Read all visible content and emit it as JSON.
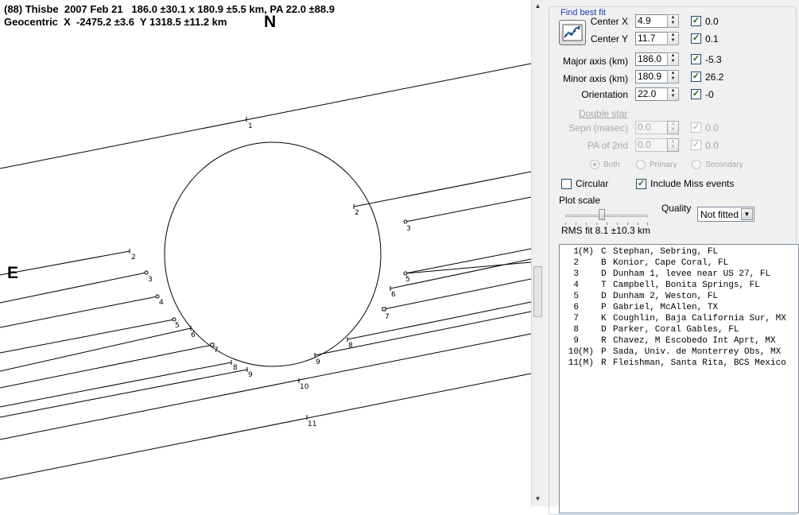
{
  "header": {
    "line1": "(88) Thisbe  2007 Feb 21   186.0 ±30.1 x 180.9 ±5.5 km, PA 22.0 ±88.9",
    "line2": "Geocentric  X  -2475.2 ±3.6  Y 1318.5 ±11.2 km"
  },
  "plot": {
    "north_label": "N",
    "east_label": "E",
    "chord_labels": [
      "1",
      "2",
      "3",
      "4",
      "5",
      "6",
      "7",
      "8",
      "9",
      "10",
      "11"
    ]
  },
  "panel": {
    "group_title": "Find best fit",
    "fit_button_icon": "fit-chart-icon",
    "center_x": {
      "label": "Center X",
      "value": "4.9",
      "checked": true,
      "uncert": "0.0"
    },
    "center_y": {
      "label": "Center Y",
      "value": "11.7",
      "checked": true,
      "uncert": "0.1"
    },
    "major_axis": {
      "label": "Major axis (km)",
      "value": "186.0",
      "checked": true,
      "uncert": "-5.3"
    },
    "minor_axis": {
      "label": "Minor axis (km)",
      "value": "180.9",
      "checked": true,
      "uncert": "26.2"
    },
    "orientation": {
      "label": "Orientation",
      "value": "22.0",
      "checked": true,
      "uncert": "-0"
    },
    "double_star": {
      "title": "Double star",
      "sepn": {
        "label": "Sepn (masec)",
        "value": "0.0",
        "uncert": "0.0"
      },
      "pa2": {
        "label": "PA of 2nd",
        "value": "0.0",
        "uncert": "0.0"
      },
      "radios": [
        "Both",
        "Primary",
        "Secondary"
      ]
    },
    "circular": {
      "label": "Circular",
      "checked": false
    },
    "include_miss": {
      "label": "Include Miss events",
      "checked": true
    },
    "plot_scale_label": "Plot scale",
    "quality": {
      "label": "Quality",
      "value": "Not fitted"
    },
    "rms_fit": "RMS fit 8.1 ±10.3 km",
    "events": [
      {
        "num": "1",
        "flag": "(M)",
        "code": "C",
        "observer": "Stephan, Sebring, FL"
      },
      {
        "num": "2",
        "flag": "",
        "code": "B",
        "observer": "Konior, Cape Coral, FL"
      },
      {
        "num": "3",
        "flag": "",
        "code": "D",
        "observer": "Dunham 1, levee near US 27, FL"
      },
      {
        "num": "4",
        "flag": "",
        "code": "T",
        "observer": "Campbell, Bonita Springs, FL"
      },
      {
        "num": "5",
        "flag": "",
        "code": "D",
        "observer": "Dunham 2, Weston, FL"
      },
      {
        "num": "6",
        "flag": "",
        "code": "P",
        "observer": "Gabriel, McAllen, TX"
      },
      {
        "num": "7",
        "flag": "",
        "code": "K",
        "observer": "Coughlin, Baja California Sur, MX"
      },
      {
        "num": "8",
        "flag": "",
        "code": "D",
        "observer": "Parker, Coral Gables, FL"
      },
      {
        "num": "9",
        "flag": "",
        "code": "R",
        "observer": "Chavez, M Escobedo Int Aprt, MX"
      },
      {
        "num": "10",
        "flag": "(M)",
        "code": "P",
        "observer": "Sada, Univ. de Monterrey Obs, MX"
      },
      {
        "num": "11",
        "flag": "(M)",
        "code": "R",
        "observer": "Fleishman, Santa Rita, BCS Mexico"
      }
    ]
  }
}
